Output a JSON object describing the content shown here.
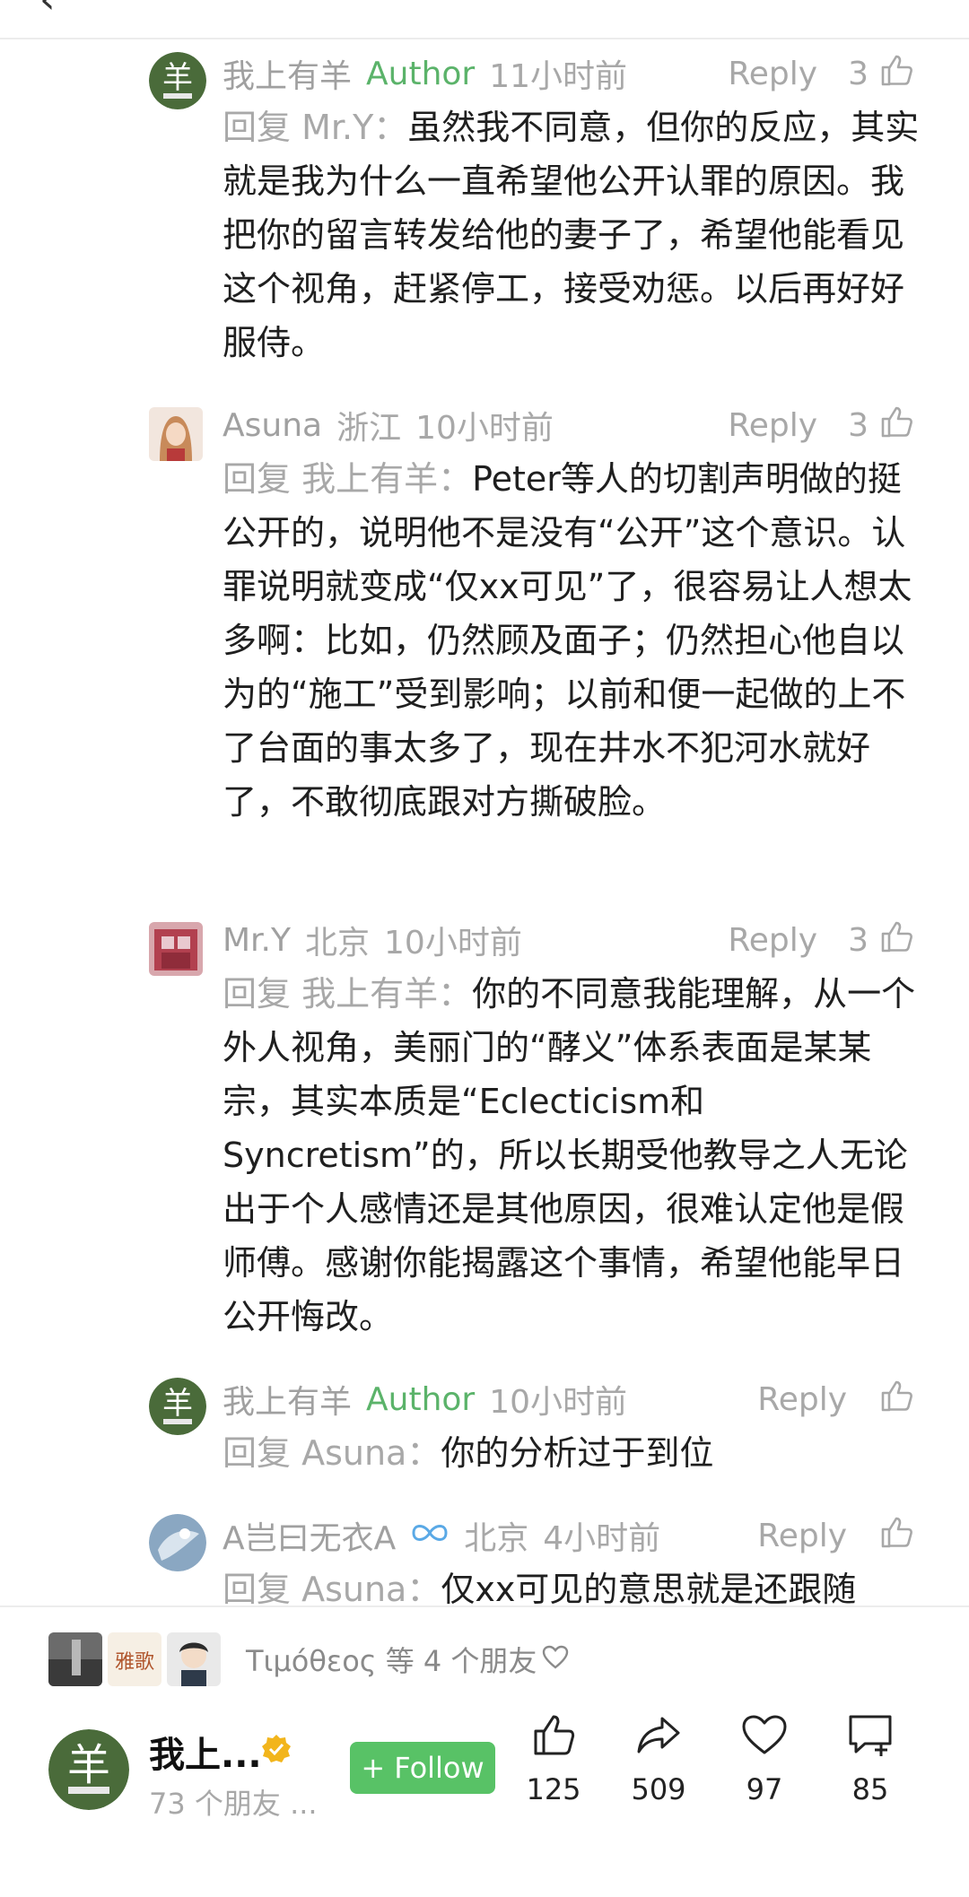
{
  "topbar": {
    "back_glyph": "‹"
  },
  "comments": [
    {
      "name": "我上有羊",
      "author_tag": "Author",
      "location": "",
      "time": "11小时前",
      "reply_label": "Reply",
      "likes": "3",
      "avatar_char": "羊",
      "reply_prefix": "回复 Mr.Y：",
      "text": "虽然我不同意，但你的反应，其实就是我为什么一直希望他公开认罪的原因。我把你的留言转发给他的妻子了，希望他能看见这个视角，赶紧停工，接受劝惩。以后再好好服侍。"
    },
    {
      "name": "Asuna",
      "author_tag": "",
      "location": "浙江",
      "time": "10小时前",
      "reply_label": "Reply",
      "likes": "3",
      "reply_prefix": "回复 我上有羊：",
      "text": "Peter等人的切割声明做的挺公开的，说明他不是没有“公开”这个意识。认罪说明就变成“仅xx可见”了，很容易让人想太多啊：比如，仍然顾及面子；仍然担心他自以为的“施工”受到影响；以前和便一起做的上不了台面的事太多了，现在井水不犯河水就好了，不敢彻底跟对方撕破脸。"
    },
    {
      "name": "Mr.Y",
      "author_tag": "",
      "location": "北京",
      "time": "10小时前",
      "reply_label": "Reply",
      "likes": "3",
      "reply_prefix": "回复 我上有羊：",
      "text": "你的不同意我能理解，从一个外人视角，美丽门的“酵义”体系表面是某某宗，其实本质是“Eclecticism和Syncretism”的，所以长期受他教导之人无论出于个人感情还是其他原因，很难认定他是假师傅。感谢你能揭露这个事情，希望他能早日公开悔改。"
    },
    {
      "name": "我上有羊",
      "author_tag": "Author",
      "location": "",
      "time": "10小时前",
      "reply_label": "Reply",
      "likes": "",
      "avatar_char": "羊",
      "reply_prefix": "回复 Asuna：",
      "text": "你的分析过于到位"
    },
    {
      "name": "A岂曰无衣A",
      "author_tag": "",
      "location": "北京",
      "time": "4小时前",
      "reply_label": "Reply",
      "likes": "",
      "reply_prefix": "回复 Asuna：",
      "text": "仅xx可见的意思就是还跟随"
    }
  ],
  "bottom": {
    "friends_text": "Τιμόθεος 等 4 个朋友",
    "mini_avatar_text": "雅歌",
    "profile_name": "我上...",
    "profile_friends": "73 个朋友 ...",
    "profile_avatar_char": "羊",
    "follow_label": "+ Follow",
    "actions": {
      "like_count": "125",
      "share_count": "509",
      "heart_count": "97",
      "comment_count": "85"
    }
  },
  "colors": {
    "author_green": "#5bb36a",
    "follow_green": "#58c266",
    "avatar_green": "#4a6b3a",
    "meta_gray": "#a8a8a8"
  }
}
